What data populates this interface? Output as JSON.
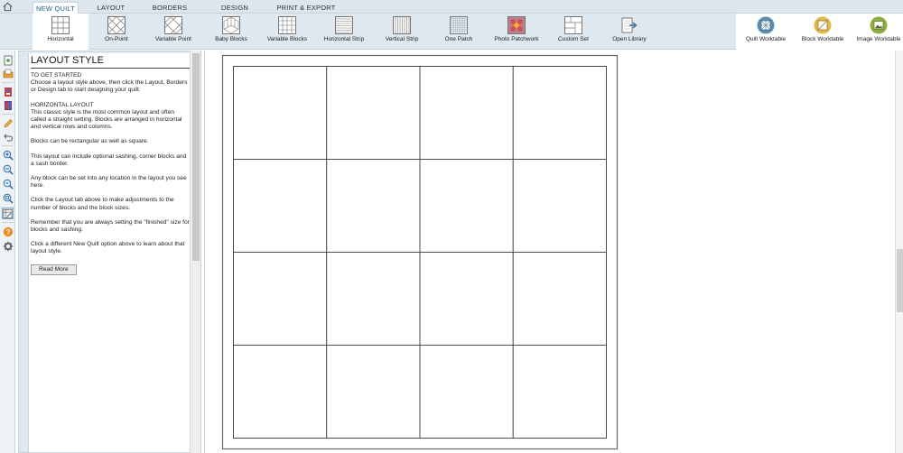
{
  "tabs": [
    {
      "label": "NEW QUILT",
      "active": true
    },
    {
      "label": "LAYOUT",
      "active": false
    },
    {
      "label": "BORDERS",
      "active": false
    },
    {
      "label": "DESIGN",
      "active": false
    },
    {
      "label": "PRINT & EXPORT",
      "active": false
    }
  ],
  "ribbon": {
    "items": [
      {
        "label": "Horizontal",
        "icon": "horizontal-layout-icon",
        "selected": true
      },
      {
        "label": "On-Point",
        "icon": "on-point-layout-icon"
      },
      {
        "label": "Variable Point",
        "icon": "variable-point-layout-icon"
      },
      {
        "label": "Baby Blocks",
        "icon": "baby-blocks-layout-icon"
      },
      {
        "label": "Variable Blocks",
        "icon": "variable-blocks-layout-icon"
      },
      {
        "label": "Horizontal Strip",
        "icon": "horizontal-strip-layout-icon"
      },
      {
        "label": "Vertical Strip",
        "icon": "vertical-strip-layout-icon"
      },
      {
        "label": "One Patch",
        "icon": "one-patch-layout-icon"
      },
      {
        "label": "Photo Patchwork",
        "icon": "photo-patchwork-icon"
      },
      {
        "label": "Custom Set",
        "icon": "custom-set-icon"
      },
      {
        "label": "Open Library",
        "icon": "open-library-icon"
      }
    ],
    "worktables": [
      {
        "label": "Quilt Worktable",
        "icon": "quilt-worktable-icon",
        "color": "#5f8fb0"
      },
      {
        "label": "Block Worktable",
        "icon": "block-worktable-icon",
        "color": "#e0b84a"
      },
      {
        "label": "Image Worktable",
        "icon": "image-worktable-icon",
        "color": "#8fae3f"
      }
    ]
  },
  "panel": {
    "title": "LAYOUT STYLE",
    "paragraphs": [
      "TO GET STARTED\nChoose a layout style above, then click the Layout, Borders or Design tab to start designing your quilt.",
      "HORIZONTAL LAYOUT\nThis classic style is the most common layout and often called a straight setting. Blocks are arranged in horizontal and vertical rows and columns.",
      "Blocks can be rectangular as well as square.",
      "This layout can include optional sashing, corner blocks and a sash border.",
      "Any block can be set into any location in the layout you see here.",
      "Click the Layout tab above to make adjustments to the number of blocks and the block sizes.",
      "Remember that you are always setting the \"finished\" size for blocks and sashing.",
      "Click a different New Quilt option above to learn about that layout style."
    ],
    "read_more": "Read More"
  },
  "quilt": {
    "columns": 4,
    "rows": 4
  },
  "colors": {
    "accent": "#1d5e8a",
    "ribbon_bg": "#dfe8ef"
  }
}
